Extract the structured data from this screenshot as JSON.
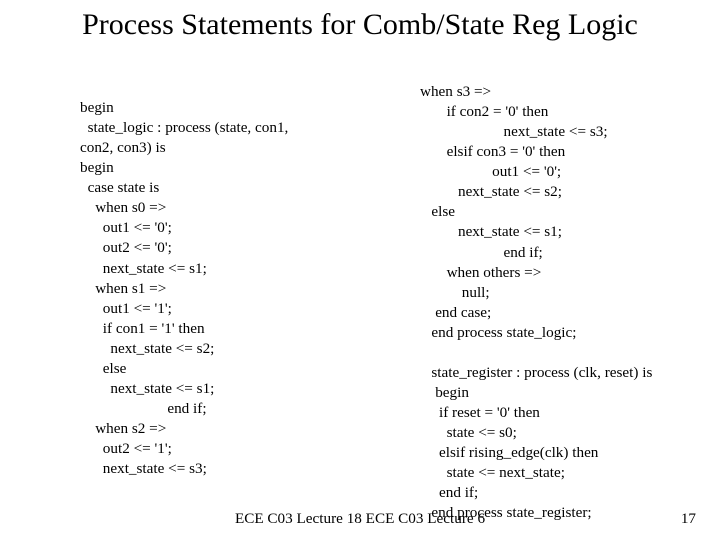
{
  "title": "Process Statements for Comb/State Reg Logic",
  "left_code": "begin\n  state_logic : process (state, con1,\ncon2, con3) is\nbegin\n  case state is\n    when s0 =>\n      out1 <= '0';\n      out2 <= '0';\n      next_state <= s1;\n    when s1 =>\n      out1 <= '1';\n      if con1 = '1' then\n        next_state <= s2;\n      else\n        next_state <= s1;\n                       end if;\n    when s2 =>\n      out2 <= '1';\n      next_state <= s3;",
  "right_code": "when s3 =>\n       if con2 = '0' then\n                      next_state <= s3;\n       elsif con3 = '0' then\n                   out1 <= '0';\n          next_state <= s2;\n   else\n          next_state <= s1;\n                      end if;\n       when others =>\n           null;\n    end case;\n   end process state_logic;\n\n   state_register : process (clk, reset) is\n    begin\n     if reset = '0' then\n       state <= s0;\n     elsif rising_edge(clk) then\n       state <= next_state;\n     end if;\n   end process state_register;",
  "footer": "ECE C03 Lecture 18 ECE C03 Lecture 6",
  "page_number": "17"
}
